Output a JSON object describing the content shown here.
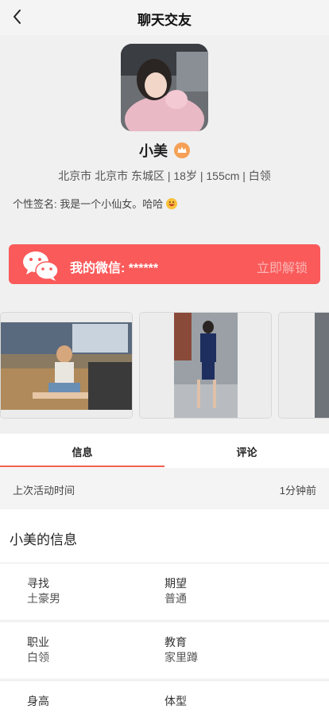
{
  "nav": {
    "title": "聊天交友"
  },
  "profile": {
    "name": "小美",
    "meta": "北京市 北京市 东城区 | 18岁 | 155cm | 白领",
    "signature": "个性签名:  我是一个小仙女。哈哈"
  },
  "wechat": {
    "label": "我的微信: ******",
    "unlock": "立即解锁"
  },
  "tabs": [
    {
      "label": "信息"
    },
    {
      "label": "评论"
    }
  ],
  "activity": {
    "label": "上次活动时间",
    "value": "1分钟前"
  },
  "info": {
    "heading": "小美的信息",
    "rows": [
      {
        "k1": "寻找",
        "v1": "土豪男",
        "k2": "期望",
        "v2": "普通"
      },
      {
        "k1": "职业",
        "v1": "白领",
        "k2": "教育",
        "v2": "家里蹲"
      },
      {
        "k1": "身高",
        "v1": "",
        "k2": "体型",
        "v2": ""
      }
    ]
  },
  "colors": {
    "accent": "#fa5a5a",
    "tab_underline": "#f06050",
    "crown": "#f5a056"
  },
  "icons": {
    "back": "back-arrow-icon",
    "crown": "crown-icon",
    "wechat": "wechat-icon",
    "emoji": "grin-emoji-icon"
  }
}
